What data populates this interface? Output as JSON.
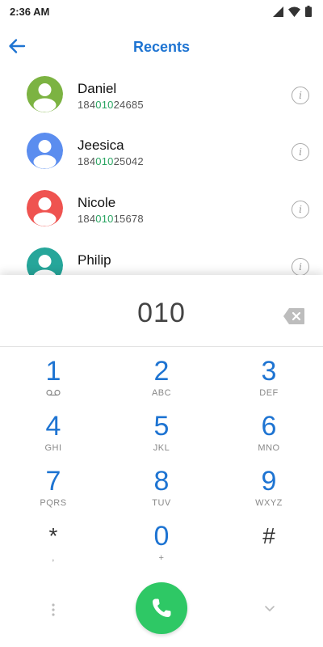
{
  "status": {
    "time": "2:36 AM"
  },
  "appbar": {
    "title": "Recents"
  },
  "contacts": [
    {
      "name": "Daniel",
      "phone_prefix": "184",
      "phone_match": "010",
      "phone_suffix": "24685",
      "avatar_color": "#7cb342"
    },
    {
      "name": "Jeesica",
      "phone_prefix": "184",
      "phone_match": "010",
      "phone_suffix": "25042",
      "avatar_color": "#5b8def"
    },
    {
      "name": "Nicole",
      "phone_prefix": "184",
      "phone_match": "010",
      "phone_suffix": "15678",
      "avatar_color": "#ef5350"
    },
    {
      "name": "Philip",
      "phone_prefix": "",
      "phone_match": "",
      "phone_suffix": "",
      "avatar_color": "#26a69a"
    }
  ],
  "info_label": "i",
  "dialer": {
    "digits": "010",
    "keys": [
      {
        "num": "1",
        "sub": ""
      },
      {
        "num": "2",
        "sub": "ABC"
      },
      {
        "num": "3",
        "sub": "DEF"
      },
      {
        "num": "4",
        "sub": "GHI"
      },
      {
        "num": "5",
        "sub": "JKL"
      },
      {
        "num": "6",
        "sub": "MNO"
      },
      {
        "num": "7",
        "sub": "PQRS"
      },
      {
        "num": "8",
        "sub": "TUV"
      },
      {
        "num": "9",
        "sub": "WXYZ"
      },
      {
        "num": "*",
        "sub": ","
      },
      {
        "num": "0",
        "sub": "+"
      },
      {
        "num": "#",
        "sub": ""
      }
    ]
  },
  "colors": {
    "accent": "#1e74d2",
    "highlight": "#2aa562",
    "call_button": "#2ec865"
  }
}
